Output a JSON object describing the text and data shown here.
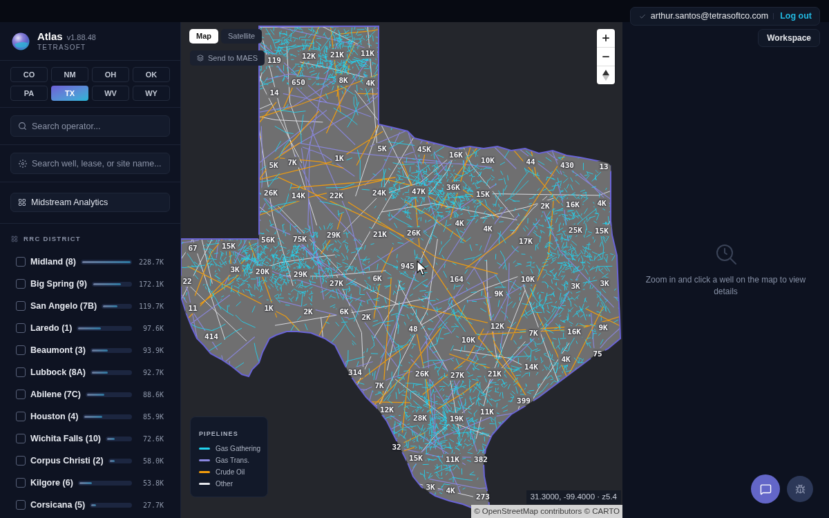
{
  "app": {
    "name": "Atlas",
    "version": "v1.88.48",
    "company": "TETRASOFT"
  },
  "account": {
    "email": "arthur.santos@tetrasoftco.com",
    "logout_link": "Log out",
    "workspace_button": "Workspace"
  },
  "state_tabs": [
    {
      "label": "CO",
      "selected": false
    },
    {
      "label": "NM",
      "selected": false
    },
    {
      "label": "OH",
      "selected": false
    },
    {
      "label": "OK",
      "selected": false
    },
    {
      "label": "PA",
      "selected": false
    },
    {
      "label": "TX",
      "selected": true
    },
    {
      "label": "WV",
      "selected": false
    },
    {
      "label": "WY",
      "selected": false
    }
  ],
  "operator_search": {
    "placeholder": "Search operator..."
  },
  "site_search": {
    "placeholder": "Search well, lease, or site name..."
  },
  "analytics_button": {
    "label": "Midstream Analytics"
  },
  "district_filter": {
    "title": "RRC DISTRICT",
    "items": [
      {
        "name": "Midland (8)",
        "checked": false,
        "level": 1.0,
        "value": "228.7K"
      },
      {
        "name": "Big Spring (9)",
        "checked": false,
        "level": 0.75,
        "value": "172.1K"
      },
      {
        "name": "San Angelo (7B)",
        "checked": false,
        "level": 0.52,
        "value": "119.7K"
      },
      {
        "name": "Laredo (1)",
        "checked": false,
        "level": 0.43,
        "value": "97.6K"
      },
      {
        "name": "Beaumont (3)",
        "checked": false,
        "level": 0.41,
        "value": "93.9K"
      },
      {
        "name": "Lubbock (8A)",
        "checked": false,
        "level": 0.41,
        "value": "92.7K"
      },
      {
        "name": "Abilene (7C)",
        "checked": false,
        "level": 0.39,
        "value": "88.6K"
      },
      {
        "name": "Houston (4)",
        "checked": false,
        "level": 0.38,
        "value": "85.9K"
      },
      {
        "name": "Wichita Falls (10)",
        "checked": false,
        "level": 0.32,
        "value": "72.6K"
      },
      {
        "name": "Corpus Christi (2)",
        "checked": false,
        "level": 0.25,
        "value": "58.0K"
      },
      {
        "name": "Kilgore (6)",
        "checked": false,
        "level": 0.24,
        "value": "53.8K"
      },
      {
        "name": "Corsicana (5)",
        "checked": false,
        "level": 0.12,
        "value": "27.7K"
      }
    ]
  },
  "map": {
    "layer_tabs": [
      {
        "label": "Map",
        "selected": true
      },
      {
        "label": "Satellite",
        "selected": false
      }
    ],
    "send_button": {
      "label": "Send to MAES"
    },
    "clusters": [
      "119",
      "12K",
      "21K",
      "11K",
      "650",
      "8K",
      "4K",
      "14",
      "5K",
      "7K",
      "1K",
      "5K",
      "45K",
      "16K",
      "10K",
      "44",
      "430",
      "13",
      "26K",
      "14K",
      "22K",
      "24K",
      "47K",
      "36K",
      "15K",
      "2K",
      "16K",
      "4K",
      "67",
      "15K",
      "56K",
      "75K",
      "29K",
      "21K",
      "26K",
      "4K",
      "4K",
      "17K",
      "25K",
      "15K",
      "22",
      "3K",
      "20K",
      "29K",
      "27K",
      "6K",
      "945",
      "164",
      "10K",
      "3K",
      "3K",
      "9K",
      "11",
      "1K",
      "2K",
      "6K",
      "2K",
      "414",
      "48",
      "10K",
      "12K",
      "7K",
      "16K",
      "9K",
      "4K",
      "75",
      "314",
      "26K",
      "27K",
      "21K",
      "14K",
      "7K",
      "399",
      "12K",
      "28K",
      "19K",
      "11K",
      "32",
      "15K",
      "11K",
      "382",
      "3K",
      "4K",
      "273"
    ],
    "legend": {
      "title": "PIPELINES",
      "items": [
        {
          "label": "Gas Gathering",
          "color": "#22d3ee"
        },
        {
          "label": "Gas Trans.",
          "color": "#8b87e0"
        },
        {
          "label": "Crude Oil",
          "color": "#f59e0b"
        },
        {
          "label": "Other",
          "color": "#e5e7eb"
        }
      ]
    },
    "coordinates": "31.3000, -99.4000 · z5.4",
    "attribution": "© OpenStreetMap contributors © CARTO"
  },
  "details_panel": {
    "message": "Zoom in and click a well on the map to view details"
  }
}
